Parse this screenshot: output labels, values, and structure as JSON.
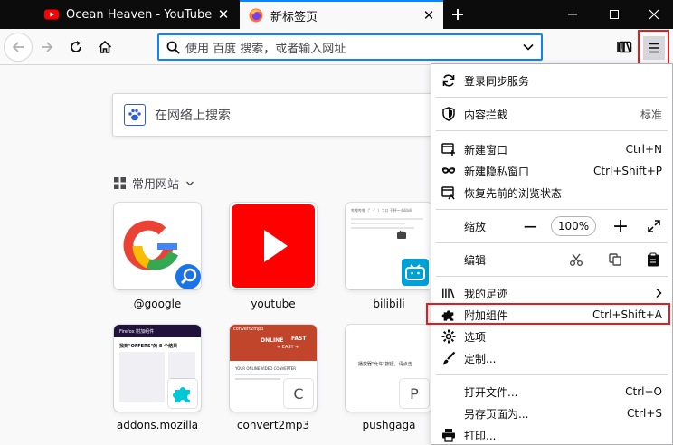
{
  "tabs": [
    {
      "title": "Ocean Heaven - YouTube",
      "icon": "youtube-icon",
      "active": false
    },
    {
      "title": "新标签页",
      "icon": "firefox-icon",
      "active": true
    }
  ],
  "urlbar": {
    "placeholder": "使用 百度 搜索，或者输入网址"
  },
  "newtab": {
    "search_placeholder": "在网络上搜索",
    "top_sites_heading": "常用网站",
    "top_sites": [
      {
        "label": "@google"
      },
      {
        "label": "youtube"
      },
      {
        "label": "bilibili"
      },
      {
        "label": "addons.mozilla"
      },
      {
        "label": "convert2mp3",
        "badge_letter": "C"
      },
      {
        "label": "pushgaga",
        "badge_letter": "P"
      }
    ],
    "thumb_text": {
      "bilibili": "哔哩哔哩（゜-゜）つロ 干杯~-bilibili",
      "addons_header": "Firefox 附加组件",
      "addons_title": "找到\"OFFERS\"的 8 个结果",
      "convert_logo": "convert2mp3",
      "convert_banner1": "ONLINE",
      "convert_banner2": "+ EASY +",
      "convert_banner3": "FAST",
      "convert_heading": "YOUR ONLINE VIDEO CONVERTER",
      "pushgaga_text": "播放器\"允许\"按钮，请点击"
    }
  },
  "menu": {
    "sync": "登录同步服务",
    "content_blocking": "内容拦截",
    "content_blocking_value": "标准",
    "new_window": "新建窗口",
    "new_window_accel": "Ctrl+N",
    "private_window": "新建隐私窗口",
    "private_window_accel": "Ctrl+Shift+P",
    "restore_session": "恢复先前的浏览状态",
    "zoom_label": "缩放",
    "zoom_value": "100%",
    "zoom_minus": "−",
    "zoom_plus": "+",
    "edit_label": "编辑",
    "library": "我的足迹",
    "addons": "附加组件",
    "addons_accel": "Ctrl+Shift+A",
    "options": "选项",
    "customize": "定制...",
    "open_file": "打开文件...",
    "open_file_accel": "Ctrl+O",
    "save_page": "另存页面为...",
    "save_page_accel": "Ctrl+S",
    "print": "打印..."
  },
  "colors": {
    "accent": "#0a84ff",
    "highlight_border": "#e31d1d",
    "tab_strip": "#0c0c0d",
    "youtube_red": "#ff0000",
    "bilibili_blue": "#00a1d6"
  }
}
